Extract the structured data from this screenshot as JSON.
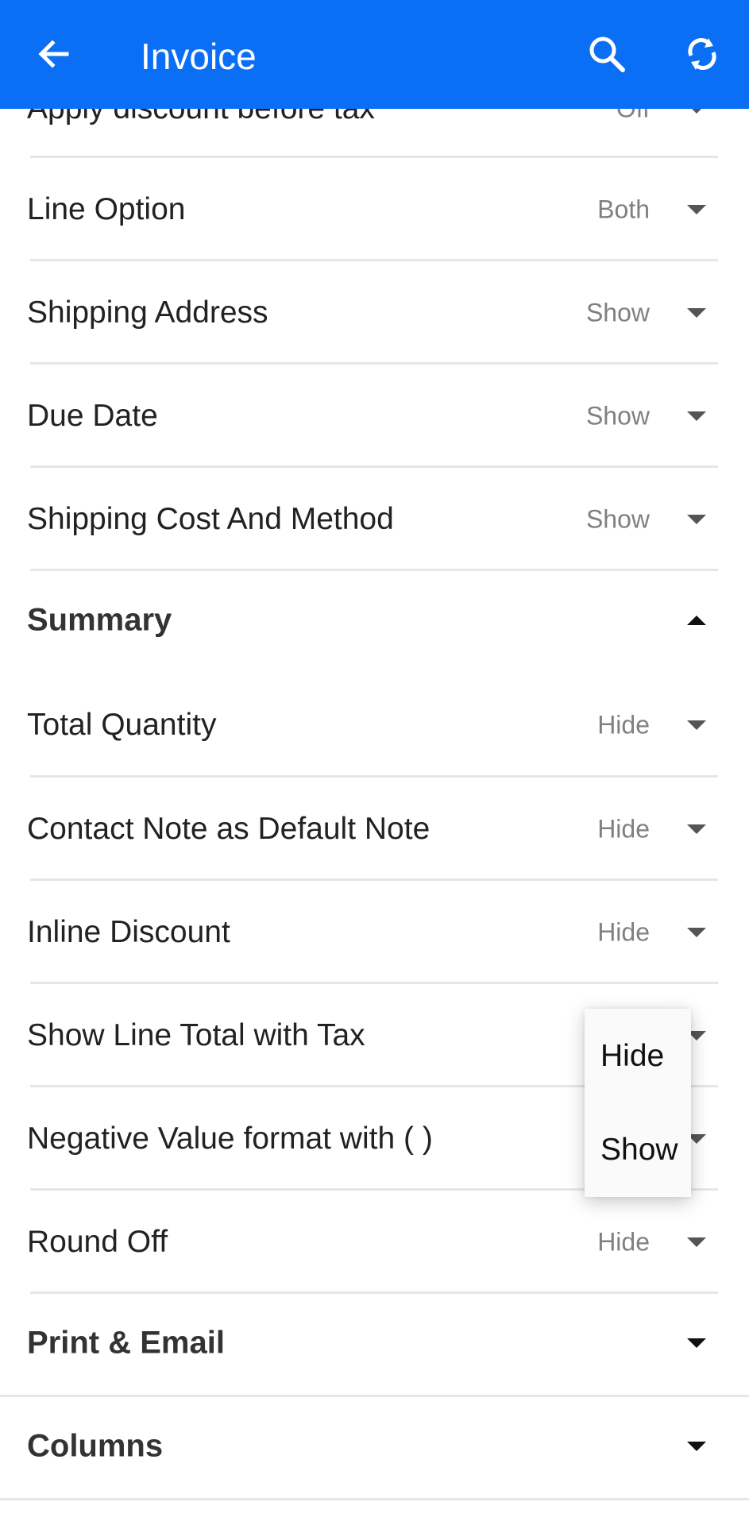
{
  "appbar": {
    "title": "Invoice",
    "back_icon": "arrow-left-icon",
    "search_icon": "search-icon",
    "sync_icon": "sync-icon",
    "color": "#0a6ff5"
  },
  "rows": [
    {
      "label": "Apply discount before tax",
      "value": "Off"
    },
    {
      "label": "Line Option",
      "value": "Both"
    },
    {
      "label": "Shipping Address",
      "value": "Show"
    },
    {
      "label": "Due Date",
      "value": "Show"
    },
    {
      "label": "Shipping Cost And Method",
      "value": "Show"
    }
  ],
  "summary_section": {
    "label": "Summary",
    "expanded": true
  },
  "summary_rows": [
    {
      "label": "Total Quantity",
      "value": "Hide"
    },
    {
      "label": "Contact Note as Default Note",
      "value": "Hide"
    },
    {
      "label": "Inline Discount",
      "value": "Hide"
    },
    {
      "label": "Show Line Total with Tax",
      "value": ""
    },
    {
      "label": "Negative Value format with ( )",
      "value": ""
    },
    {
      "label": "Round Off",
      "value": "Hide"
    }
  ],
  "sections": [
    {
      "label": "Print & Email",
      "expanded": false
    },
    {
      "label": "Columns",
      "expanded": false
    }
  ],
  "dropdown_menu": {
    "options": [
      "Hide",
      "Show"
    ]
  }
}
